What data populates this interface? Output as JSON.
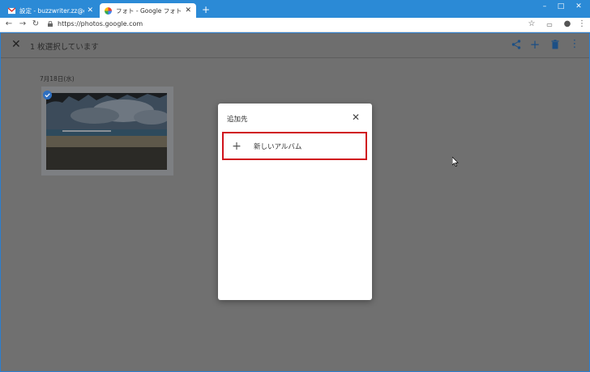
{
  "browser": {
    "tabs": [
      {
        "title": "設定 - buzzwriter.zz@gmail.com",
        "active": false
      },
      {
        "title": "フォト - Google フォト",
        "active": true
      }
    ],
    "new_tab_icon": "plus-icon",
    "window_controls": {
      "minimize": "–",
      "maximize": "□",
      "close": "✕"
    },
    "url": "https://photos.google.com"
  },
  "app": {
    "selection_text": "1 枚選択しています",
    "actions": [
      "share-icon",
      "add-icon",
      "delete-icon",
      "more-vert-icon"
    ],
    "date_header": "7月18日(水)"
  },
  "dialog": {
    "title": "追加先",
    "new_album_label": "新しいアルバム"
  },
  "colors": {
    "titlebar": "#2b8ad6",
    "overlay_grey": "#707070",
    "highlight_red": "#d0121b",
    "action_blue": "#1c4f85"
  }
}
